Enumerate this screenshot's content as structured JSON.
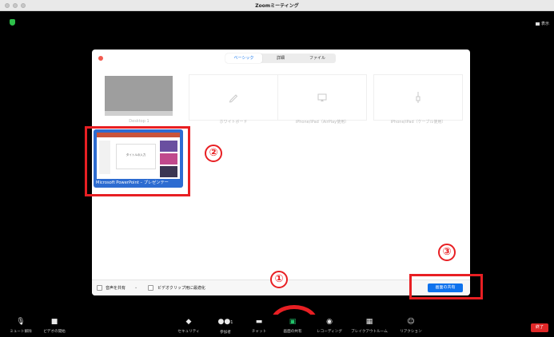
{
  "window": {
    "title": "Zoomミーティング"
  },
  "top_right": {
    "view_label": "表示"
  },
  "dialog": {
    "tabs": [
      {
        "label": "ベーシック",
        "active": true
      },
      {
        "label": "詳細",
        "active": false
      },
      {
        "label": "ファイル",
        "active": false
      }
    ],
    "sources": [
      {
        "label": "Desktop 1",
        "icon": "desktop-thumbnail"
      },
      {
        "label": "ホワイトボード",
        "icon": "pencil-icon"
      },
      {
        "label": "iPhone/iPad（AirPlay使用）",
        "icon": "airplay-icon"
      },
      {
        "label": "iPhone/iPad（ケーブル使用）",
        "icon": "cable-icon"
      }
    ],
    "selected_window": {
      "label": "Microsoft PowerPoint – プレゼンテー",
      "slide_title": "タイトルの入力"
    },
    "share_audio_label": "音声を共有",
    "optimize_video_label": "ビデオクリップ用に最適化",
    "share_button_label": "画面の共有"
  },
  "annotations": {
    "num1": "①",
    "num2": "②",
    "num3": "③"
  },
  "toolbar": {
    "mute_label": "ミュート解除",
    "video_label": "ビデオの開始",
    "security_label": "セキュリティ",
    "participants_label": "参加者",
    "participants_count": "1",
    "chat_label": "チャット",
    "share_label": "画面の共有",
    "record_label": "レコーディング",
    "breakout_label": "ブレイクアウトルーム",
    "reactions_label": "リアクション",
    "end_label": "終了"
  },
  "colors": {
    "accent": "#0e72ed",
    "annotation_red": "#e81f23",
    "end_red": "#e02828",
    "share_green": "#23c36b"
  }
}
